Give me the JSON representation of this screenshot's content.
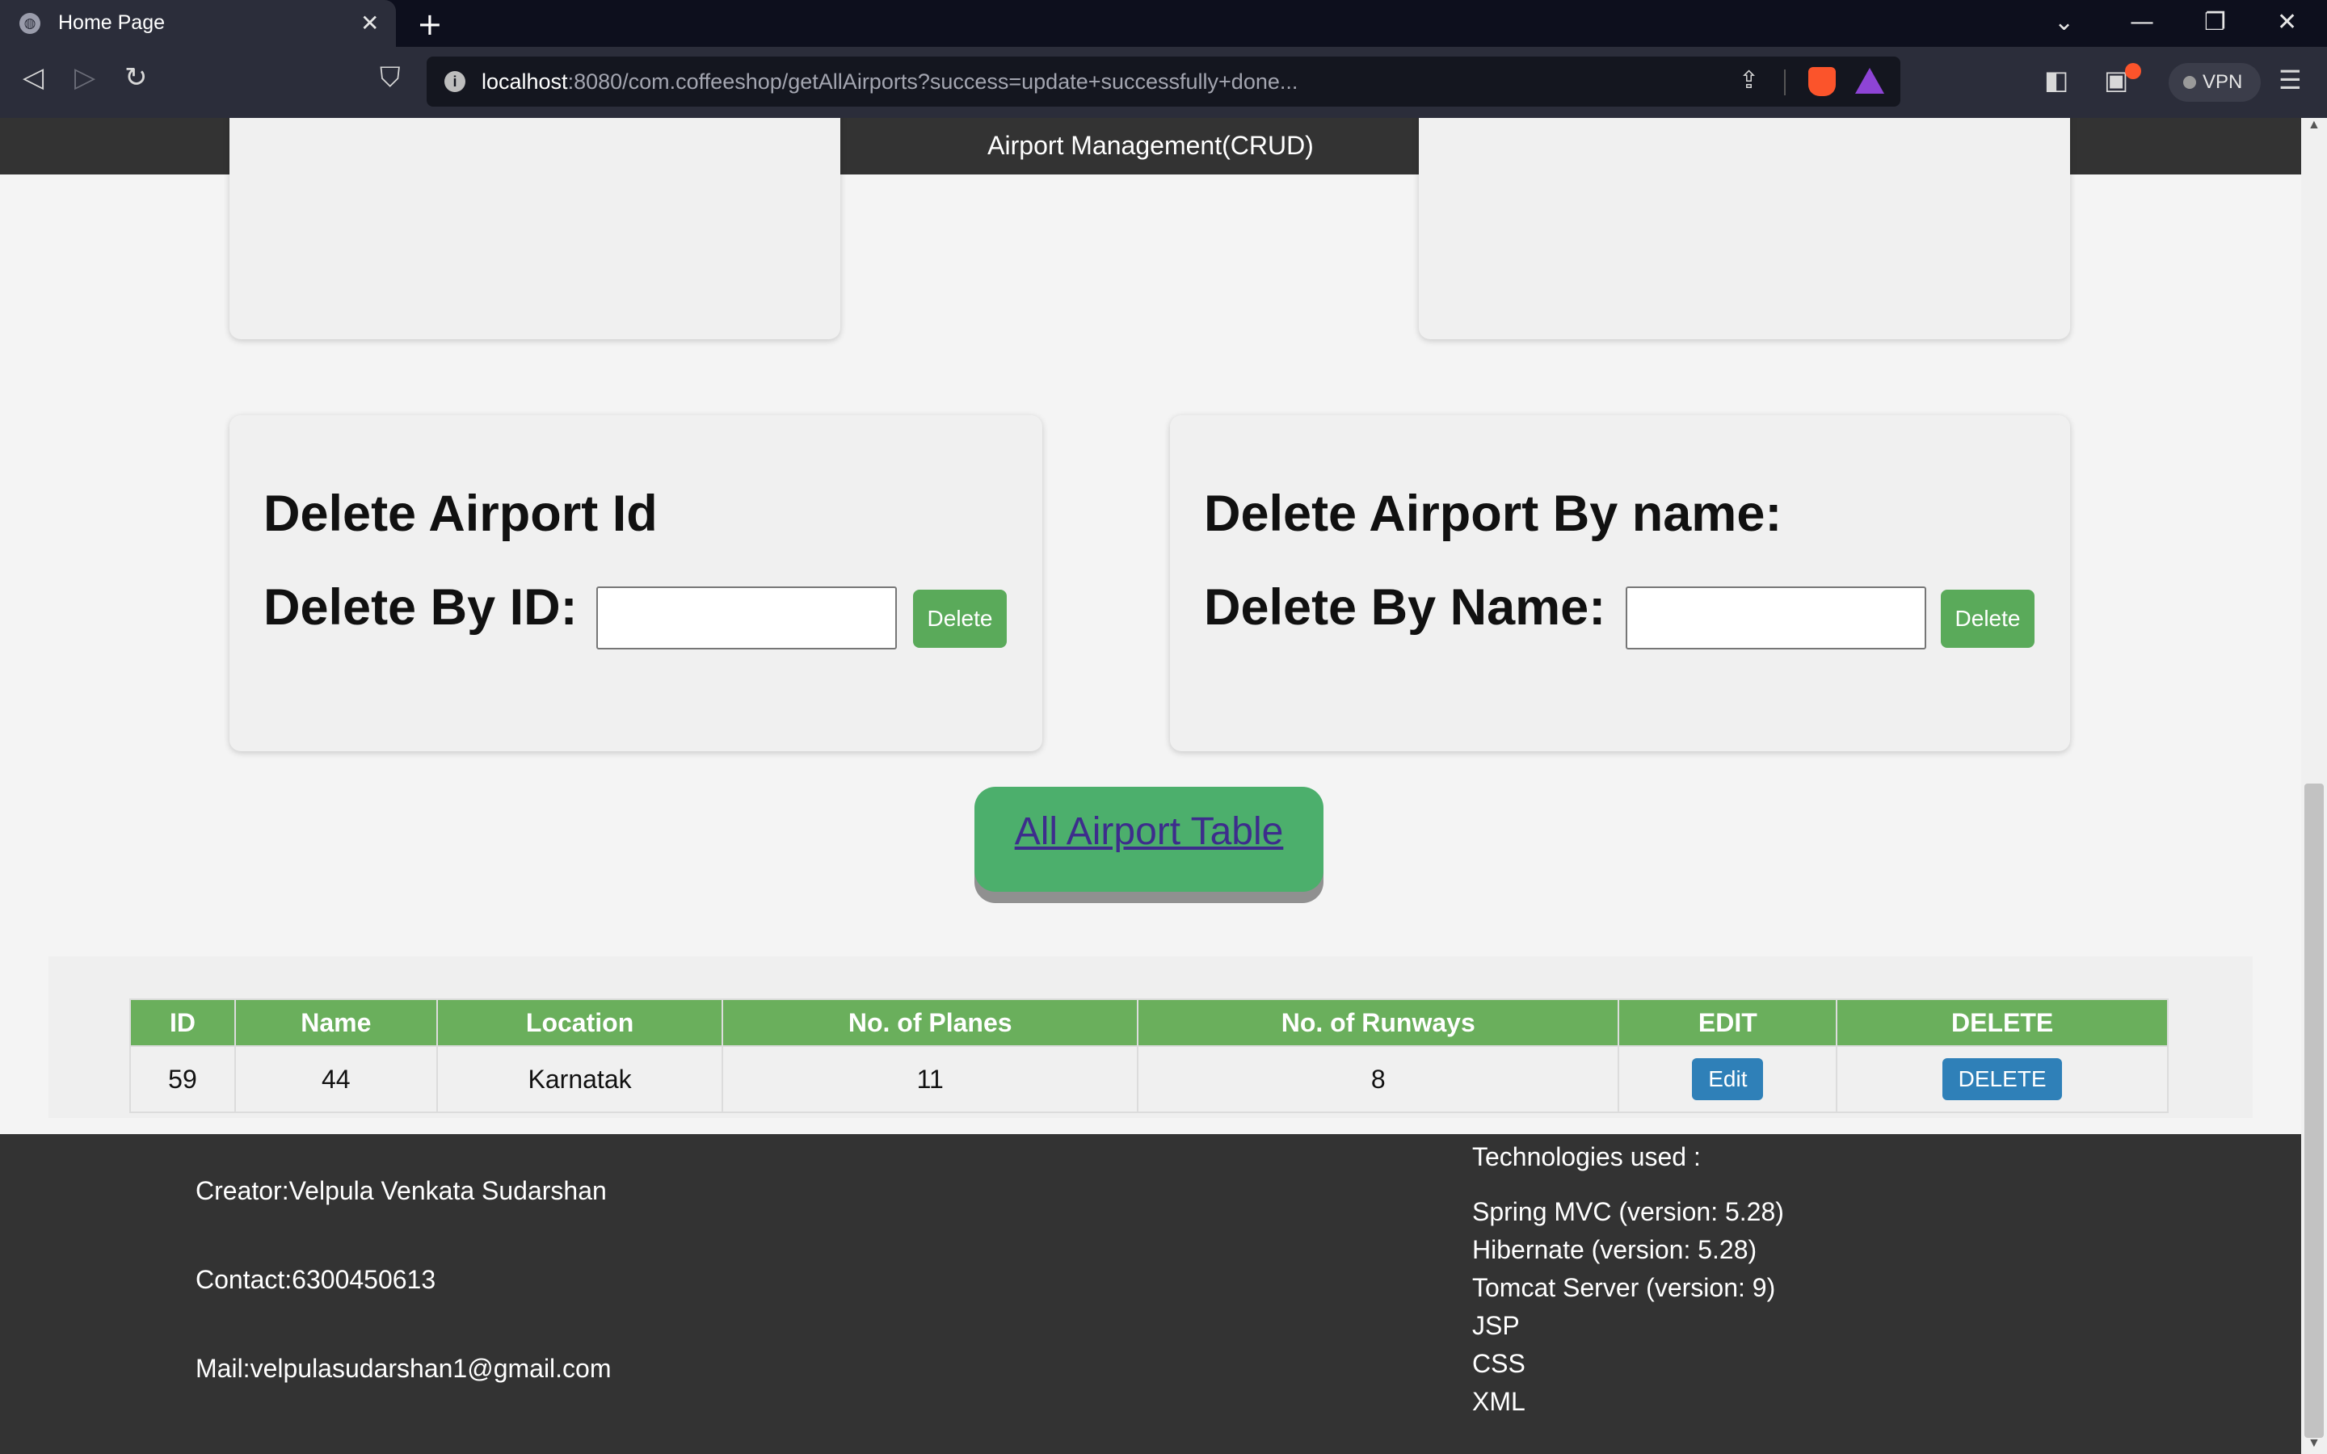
{
  "browser": {
    "tab_title": "Home Page",
    "tab_close": "✕",
    "new_tab": "+",
    "url_host": "localhost",
    "url_rest": ":8080/com.coffeeshop/getAllAirports?success=update+successfully+done...",
    "vpn_label": "VPN",
    "icons": [
      "globe-icon",
      "back-icon",
      "forward-icon",
      "reload-icon",
      "bookmark-icon",
      "share-icon",
      "brave-shields-icon",
      "brave-rewards-icon",
      "sidebar-icon",
      "wallet-icon",
      "menu-icon"
    ]
  },
  "app": {
    "header_title": "Airport Management(CRUD)"
  },
  "delete_by_id": {
    "heading": "Delete Airport Id",
    "label": "Delete By ID:",
    "input_value": "",
    "button": "Delete"
  },
  "delete_by_name": {
    "heading": "Delete Airport By name:",
    "label": "Delete By Name:",
    "input_value": "",
    "button": "Delete"
  },
  "all_table_link": "All Airport Table",
  "table": {
    "headers": [
      "ID",
      "Name",
      "Location",
      "No. of Planes",
      "No. of Runways",
      "EDIT",
      "DELETE"
    ],
    "rows": [
      {
        "id": "59",
        "name": "44",
        "location": "Karnatak",
        "planes": "11",
        "runways": "8",
        "edit": "Edit",
        "delete": "DELETE"
      }
    ]
  },
  "footer": {
    "creator": "Creator:Velpula Venkata Sudarshan",
    "contact": "Contact:6300450613",
    "mail": "Mail:velpulasudarshan1@gmail.com",
    "tech_heading": "Technologies used :",
    "tech": [
      "Spring MVC (version: 5.28)",
      "Hibernate (version: 5.28)",
      "Tomcat Server (version: 9)",
      "JSP",
      "CSS",
      "XML"
    ]
  },
  "colors": {
    "header_bg": "#333333",
    "green_button": "#5aaa5a",
    "table_header": "#6aaf5c",
    "blue_button": "#2f80b8",
    "link_button": "#4caf6c"
  }
}
